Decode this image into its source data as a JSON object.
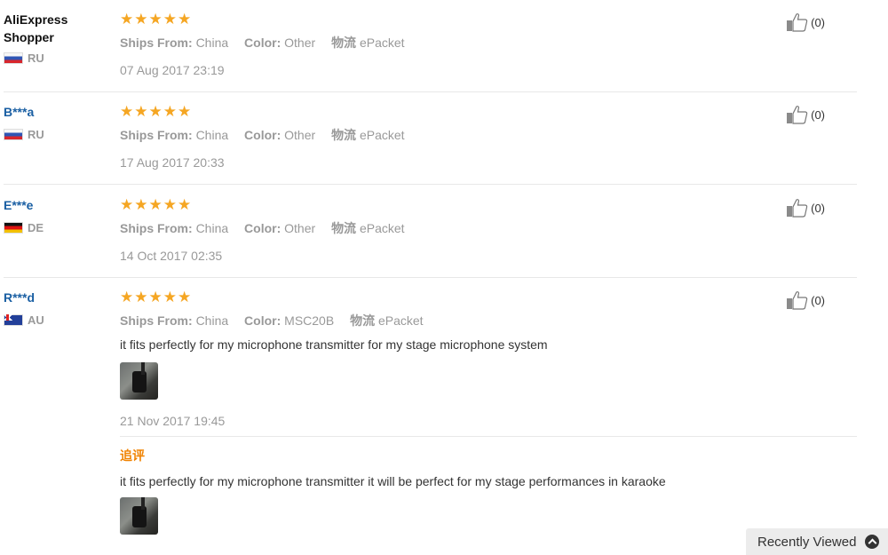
{
  "labels": {
    "ships_from": "Ships From:",
    "color": "Color:",
    "logistics": "物流",
    "followup": "追评"
  },
  "reviews": [
    {
      "user": "AliExpress Shopper",
      "user_line1": "AliExpress",
      "user_line2": "Shopper",
      "country": "RU",
      "stars": "★★★★★",
      "rating": 5,
      "ships_from": "China",
      "color": "Other",
      "logistics": "ePacket",
      "date": "07 Aug 2017 23:19",
      "likes": "(0)"
    },
    {
      "user": "B***a",
      "country": "RU",
      "stars": "★★★★★",
      "rating": 5,
      "ships_from": "China",
      "color": "Other",
      "logistics": "ePacket",
      "date": "17 Aug 2017 20:33",
      "likes": "(0)"
    },
    {
      "user": "E***e",
      "country": "DE",
      "stars": "★★★★★",
      "rating": 5,
      "ships_from": "China",
      "color": "Other",
      "logistics": "ePacket",
      "date": "14 Oct 2017 02:35",
      "likes": "(0)"
    },
    {
      "user": "R***d",
      "country": "AU",
      "stars": "★★★★★",
      "rating": 5,
      "ships_from": "China",
      "color": "MSC20B",
      "logistics": "ePacket",
      "text": "it fits perfectly for my microphone transmitter for my stage microphone system",
      "date": "21 Nov 2017 19:45",
      "likes": "(0)",
      "followup_text": "it fits perfectly for my microphone transmitter it will be perfect for my stage performances in karaoke"
    }
  ],
  "recently_viewed": {
    "label": "Recently Viewed",
    "icon": "chevron-up-circle-icon"
  },
  "colors": {
    "star": "#f5a623",
    "username_link": "#1a5fa3",
    "followup_label": "#f08200"
  }
}
